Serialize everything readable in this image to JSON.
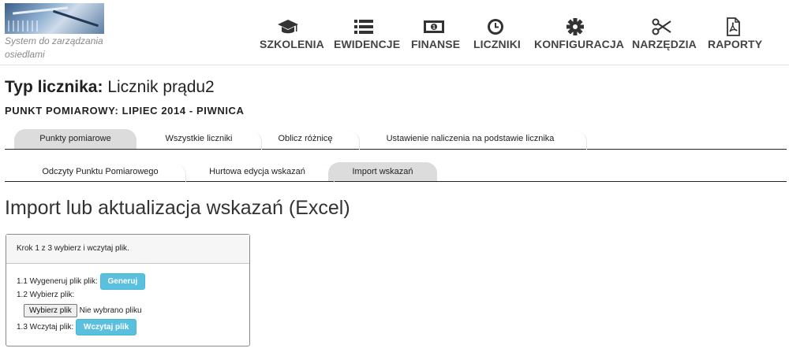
{
  "header": {
    "tagline": "System do zarządzania osiedlami",
    "nav": [
      {
        "label": "SZKOLENIA",
        "icon": "graduation-cap-icon"
      },
      {
        "label": "EWIDENCJE",
        "icon": "list-icon"
      },
      {
        "label": "FINANSE",
        "icon": "money-icon"
      },
      {
        "label": "LICZNIKI",
        "icon": "clock-icon"
      },
      {
        "label": "KONFIGURACJA",
        "icon": "gear-icon"
      },
      {
        "label": "NARZĘDZIA",
        "icon": "scissors-icon"
      },
      {
        "label": "RAPORTY",
        "icon": "pdf-file-icon"
      }
    ]
  },
  "page": {
    "title_label": "Typ licznika:",
    "title_value": "Licznik prądu2",
    "subtitle": "PUNKT POMIAROWY: LIPIEC 2014 - PIWNICA",
    "heading": "Import lub aktualizacja wskazań (Excel)"
  },
  "tabs1": [
    {
      "label": "Punkty pomiarowe",
      "active": true
    },
    {
      "label": "Wszystkie liczniki",
      "active": false
    },
    {
      "label": "Oblicz różnicę",
      "active": false
    },
    {
      "label": "Ustawienie naliczenia na podstawie licznika",
      "active": false
    }
  ],
  "tabs2": [
    {
      "label": "Odczyty Punktu Pomiarowego",
      "active": false
    },
    {
      "label": "Hurtowa edycja wskazań",
      "active": false
    },
    {
      "label": "Import wskazań",
      "active": true
    }
  ],
  "panel": {
    "header": "Krok 1 z 3 wybierz i wczytaj plik.",
    "step1_label": "1.1 Wygeneruj plik plik:",
    "step1_button": "Generuj",
    "step2_label": "1.2 Wybierz plik:",
    "file_button": "Wybierz plik",
    "file_status": "Nie wybrano pliku",
    "step3_label": "1.3 Wczytaj plik:",
    "step3_button": "Wczytaj plik"
  },
  "colors": {
    "accent_button": "#5bc0de",
    "active_tab": "#dcdcdc"
  }
}
